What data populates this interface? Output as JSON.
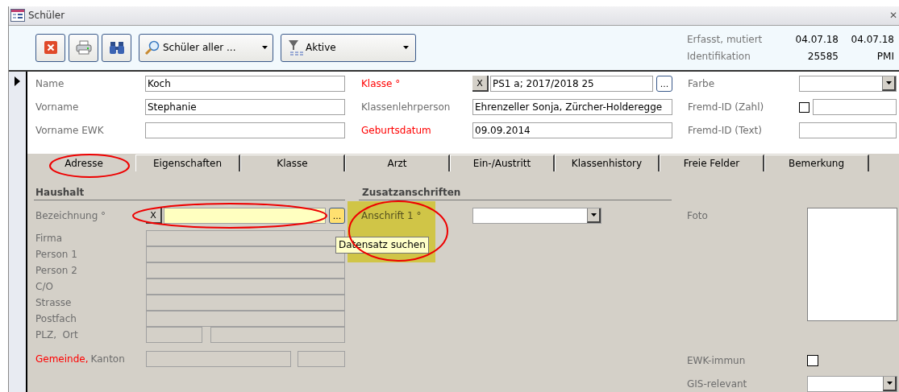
{
  "window": {
    "title": "Schüler",
    "close": "✕"
  },
  "toolbar": {
    "icon_buttons": [
      {
        "kind": "delete"
      },
      {
        "kind": "print"
      },
      {
        "kind": "find"
      }
    ],
    "search_dropdown": {
      "value": "Schüler aller ..."
    },
    "filter_dropdown": {
      "value": "Aktive"
    },
    "meta": [
      {
        "label": "Erfasst, mutiert",
        "values": [
          "04.07.18",
          "04.07.18"
        ]
      },
      {
        "label": "Identifikation",
        "values": [
          "25585",
          "PMI"
        ]
      }
    ]
  },
  "header_rows": [
    [
      {
        "label": "Name",
        "required": false,
        "kind": "text",
        "value": "Koch"
      },
      {
        "label": "Klasse °",
        "required": true,
        "kind": "lookup",
        "clear": "X",
        "value": "PS1 a; 2017/2018 25",
        "more": "..."
      },
      {
        "label": "Farbe",
        "required": false,
        "kind": "dropdown"
      }
    ],
    [
      {
        "label": "Vorname",
        "required": false,
        "kind": "text",
        "value": "Stephanie"
      },
      {
        "label": "Klassenlehrperson",
        "required": false,
        "kind": "text",
        "value": "Ehrenzeller Sonja, Zürcher-Holderegge"
      },
      {
        "label": "Fremd-ID (Zahl)",
        "required": false,
        "kind": "checkbox_text",
        "checked": false
      }
    ],
    [
      {
        "label": "Vorname EWK",
        "required": false,
        "kind": "text"
      },
      {
        "label": "Geburtsdatum",
        "required": true,
        "kind": "text",
        "value": "09.09.2014"
      },
      {
        "label": "Fremd-ID (Text)",
        "required": false,
        "kind": "text"
      }
    ]
  ],
  "tabs": [
    {
      "label": "Adresse",
      "selected": true
    },
    {
      "label": "Eigenschaften",
      "selected": false
    },
    {
      "label": "Klasse",
      "selected": false
    },
    {
      "label": "Arzt",
      "selected": false
    },
    {
      "label": "Ein-/Austritt",
      "selected": false
    },
    {
      "label": "Klassenhistory",
      "selected": false
    },
    {
      "label": "Freie Felder",
      "selected": false
    },
    {
      "label": "Bemerkung",
      "selected": false
    }
  ],
  "haushalt": {
    "title": "Haushalt",
    "bezeichnung": {
      "label": "Bezeichnung °",
      "clear": "X",
      "more": "..."
    },
    "fields": [
      {
        "label": "Firma",
        "kind": "single"
      },
      {
        "label": "Person 1",
        "kind": "single"
      },
      {
        "label": "Person 2",
        "kind": "single"
      },
      {
        "label": "C/O",
        "kind": "single"
      },
      {
        "label": "Strasse",
        "kind": "single"
      },
      {
        "label": "Postfach",
        "kind": "single"
      },
      {
        "label": "PLZ,  Ort",
        "kind": "split"
      }
    ],
    "gemeinde": [
      {
        "text": "Gemeinde,",
        "required": true
      },
      {
        "text": "Kanton",
        "required": false
      }
    ]
  },
  "zusatzanschriften": {
    "title": "Zusatzanschriften",
    "fields": [
      {
        "label": "Anschrift 1 °"
      }
    ]
  },
  "right": {
    "foto": {
      "label": "Foto"
    },
    "ewk_immun": {
      "label": "EWK-immun",
      "checked": false
    },
    "gis": {
      "label": "GIS-relevant"
    }
  },
  "tooltip": {
    "text": "Datensatz suchen"
  }
}
